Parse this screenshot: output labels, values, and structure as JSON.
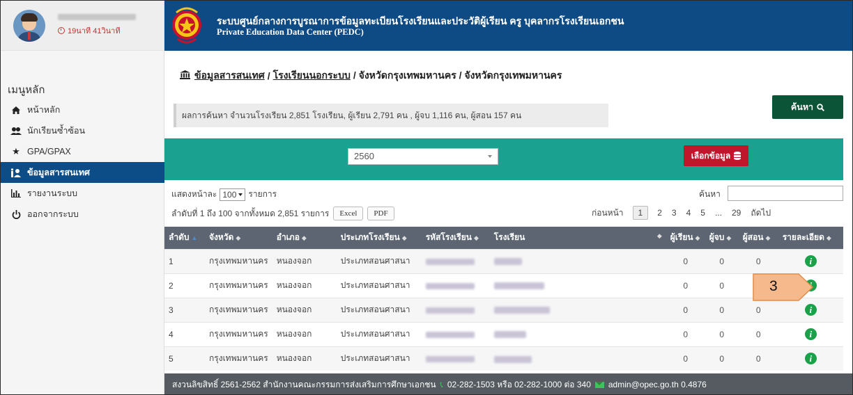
{
  "profile": {
    "time": "19นาที 41วินาที"
  },
  "sidebar": {
    "title": "เมนูหลัก",
    "items": [
      {
        "label": "หน้าหลัก",
        "icon": "home-icon"
      },
      {
        "label": "นักเรียนซ้ำซ้อน",
        "icon": "users-icon"
      },
      {
        "label": "GPA/GPAX",
        "icon": "star-icon"
      },
      {
        "label": "ข้อมูลสารสนเทศ",
        "icon": "info-people-icon"
      },
      {
        "label": "รายงานระบบ",
        "icon": "chart-icon"
      },
      {
        "label": "ออกจากระบบ",
        "icon": "power-icon"
      }
    ]
  },
  "header": {
    "title": "ระบบศูนย์กลางการบูรณาการข้อมูลทะเบียนโรงเรียนและประวัติผู้เรียน ครู บุคลากรโรงเรียนเอกชน",
    "subtitle": "Private Education Data Center (PEDC)"
  },
  "breadcrumb": {
    "link1": "ข้อมูลสารสนเทศ",
    "sep1": "/",
    "link2": "โรงเรียนนอกระบบ",
    "rest": "/ จังหวัดกรุงเทพมหานคร / จังหวัดกรุงเทพมหานคร"
  },
  "search_button": "ค้นหา",
  "result_summary": "ผลการค้นหา จำนวนโรงเรียน 2,851 โรงเรียน, ผู้เรียน 2,791 คน , ผู้จบ 1,116 คน, ผู้สอน 157 คน",
  "filter": {
    "year": "2560",
    "select_button": "เลือกข้อมูล"
  },
  "length": {
    "prefix": "แสดงหน้าละ",
    "value": "100",
    "suffix": "รายการ"
  },
  "search": {
    "label": "ค้นหา"
  },
  "info_text": "ลำดับที่ 1 ถึง 100 จากทั้งหมด 2,851 รายการ",
  "export": {
    "excel": "Excel",
    "pdf": "PDF"
  },
  "pagination": {
    "prev": "ก่อนหน้า",
    "pages": [
      "1",
      "2",
      "3",
      "4",
      "5",
      "...",
      "29"
    ],
    "next": "ถัดไป"
  },
  "table": {
    "headers": [
      "ลำดับ",
      "จังหวัด",
      "อำเภอ",
      "ประเภทโรงเรียน",
      "รหัสโรงเรียน",
      "โรงเรียน",
      "ผู้เรียน",
      "ผู้จบ",
      "ผู้สอน",
      "รายละเอียด"
    ],
    "rows": [
      {
        "no": "1",
        "province": "กรุงเทพมหานคร",
        "district": "หนองจอก",
        "type": "ประเภทสอนศาสนา",
        "students": "0",
        "graduates": "0",
        "teachers": "0"
      },
      {
        "no": "2",
        "province": "กรุงเทพมหานคร",
        "district": "หนองจอก",
        "type": "ประเภทสอนศาสนา",
        "students": "0",
        "graduates": "0",
        "teachers": "0"
      },
      {
        "no": "3",
        "province": "กรุงเทพมหานคร",
        "district": "หนองจอก",
        "type": "ประเภทสอนศาสนา",
        "students": "0",
        "graduates": "0",
        "teachers": "0"
      },
      {
        "no": "4",
        "province": "กรุงเทพมหานคร",
        "district": "หนองจอก",
        "type": "ประเภทสอนศาสนา",
        "students": "0",
        "graduates": "0",
        "teachers": "0"
      },
      {
        "no": "5",
        "province": "กรุงเทพมหานคร",
        "district": "หนองจอก",
        "type": "ประเภทสอนศาสนา",
        "students": "0",
        "graduates": "0",
        "teachers": "0"
      }
    ]
  },
  "callout": {
    "number": "3"
  },
  "footer": {
    "copyright": "สงวนลิขสิทธิ์ 2561-2562 สำนักงานคณะกรรมการส่งเสริมการศึกษาเอกชน",
    "phone": "02-282-1503 หรือ 02-282-1000 ต่อ 340",
    "email": "admin@opec.go.th 0.4876"
  },
  "colors": {
    "header": "#0e4a84",
    "filter_bar": "#1aa18f",
    "search_button": "#0b5438",
    "select_button": "#c0162c",
    "table_header": "#5d6572",
    "footer": "#555b61",
    "info_icon": "#1aa14a",
    "callout": "#f6b98c"
  }
}
